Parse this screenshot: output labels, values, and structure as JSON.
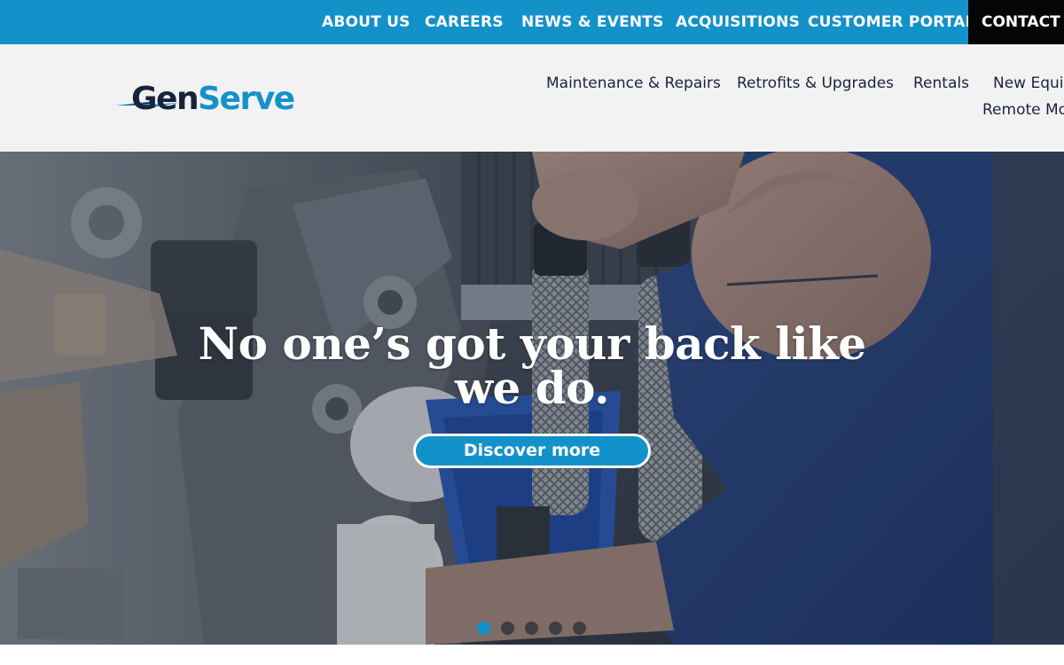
{
  "colors": {
    "brand_blue": "#1392c9",
    "brand_navy": "#17243c",
    "contact_bg": "#050505",
    "nav_bg": "#f2f2f2"
  },
  "top_nav": {
    "items": [
      {
        "label": "ABOUT US"
      },
      {
        "label": "CAREERS"
      },
      {
        "label": "NEWS & EVENTS"
      },
      {
        "label": "ACQUISITIONS"
      },
      {
        "label": "CUSTOMER PORTAL"
      }
    ],
    "contact_label": "CONTACT"
  },
  "logo": {
    "text_gen": "Gen",
    "text_serve": "Serve",
    "icon": "lightning-bolt-icon"
  },
  "main_nav": {
    "items": [
      {
        "label": "Maintenance & Repairs"
      },
      {
        "label": "Retrofits & Upgrades"
      },
      {
        "label": "Rentals"
      },
      {
        "label": "New Equip"
      },
      {
        "label": "Remote Mo"
      }
    ]
  },
  "hero": {
    "headline": "No one’s got your back like we do.",
    "cta_label": "Discover more",
    "slides_total": 5,
    "active_slide": 1
  }
}
